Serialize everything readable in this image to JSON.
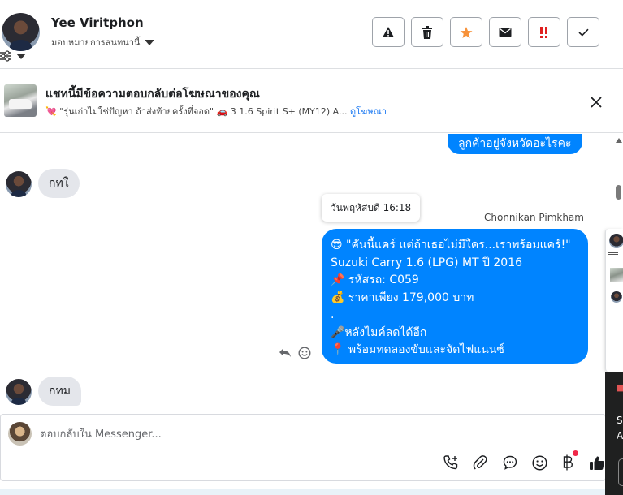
{
  "header": {
    "contact_name": "Yee Viritphon",
    "assign_label": "มอบหมายการสนทนานี้",
    "actions": [
      {
        "name": "report-spam-button",
        "icon": "warning-icon"
      },
      {
        "name": "delete-button",
        "icon": "trash-icon"
      },
      {
        "name": "follow-up-button",
        "icon": "star-icon"
      },
      {
        "name": "mark-unread-button",
        "icon": "envelope-icon"
      },
      {
        "name": "mark-important-button",
        "icon": "double-exclamation-icon"
      },
      {
        "name": "mark-done-button",
        "icon": "check-icon"
      }
    ]
  },
  "ad_banner": {
    "title": "แชทนี้มีข้อความตอบกลับต่อโฆษณาของคุณ",
    "subtitle": "💘 \"รุ่นเก่าไม่ใช่ปัญหา ถ้าส่งท้ายครั้งที่จอด\" 🚗 3 1.6 Spirit S+ (MY12) A...",
    "link_label": "ดูโฆษณา"
  },
  "messages": {
    "outgoing_top": "ลูกค้าอยู่จังหวัดอะไรคะ",
    "incoming_1": "กทใ",
    "timestamp_tooltip": "วันพฤหัสบดี 16:18",
    "sender_name": "Chonnikan Pimkham",
    "outgoing_main": [
      "😎 \"คันนี้แคร์ แต่ถ้าเธอไม่มีใคร...เราพร้อมแคร์!\"",
      "Suzuki Carry 1.6 (LPG) MT ปี 2016",
      "📌 รหัสรถ: C059",
      "💰 ราคาเพียง 179,000 บาท",
      ".",
      "🎤หลังไมค์ลดได้อีก",
      "📍 พร้อมทดลองขับและจัดไฟแนนซ์"
    ],
    "incoming_2": "กทม"
  },
  "composer": {
    "placeholder": "ตอบกลับใน Messenger...",
    "tools": [
      "call-add-icon",
      "attachment-icon",
      "saved-reply-icon",
      "emoji-icon",
      "baht-payment-icon",
      "thumbs-up-icon"
    ]
  },
  "side_panel": {
    "chars": [
      "",
      "S",
      "A"
    ]
  },
  "colors": {
    "accent": "#0084ff",
    "incoming_bubble": "#e4e6eb",
    "star": "#f7923a",
    "important": "#e02020"
  }
}
